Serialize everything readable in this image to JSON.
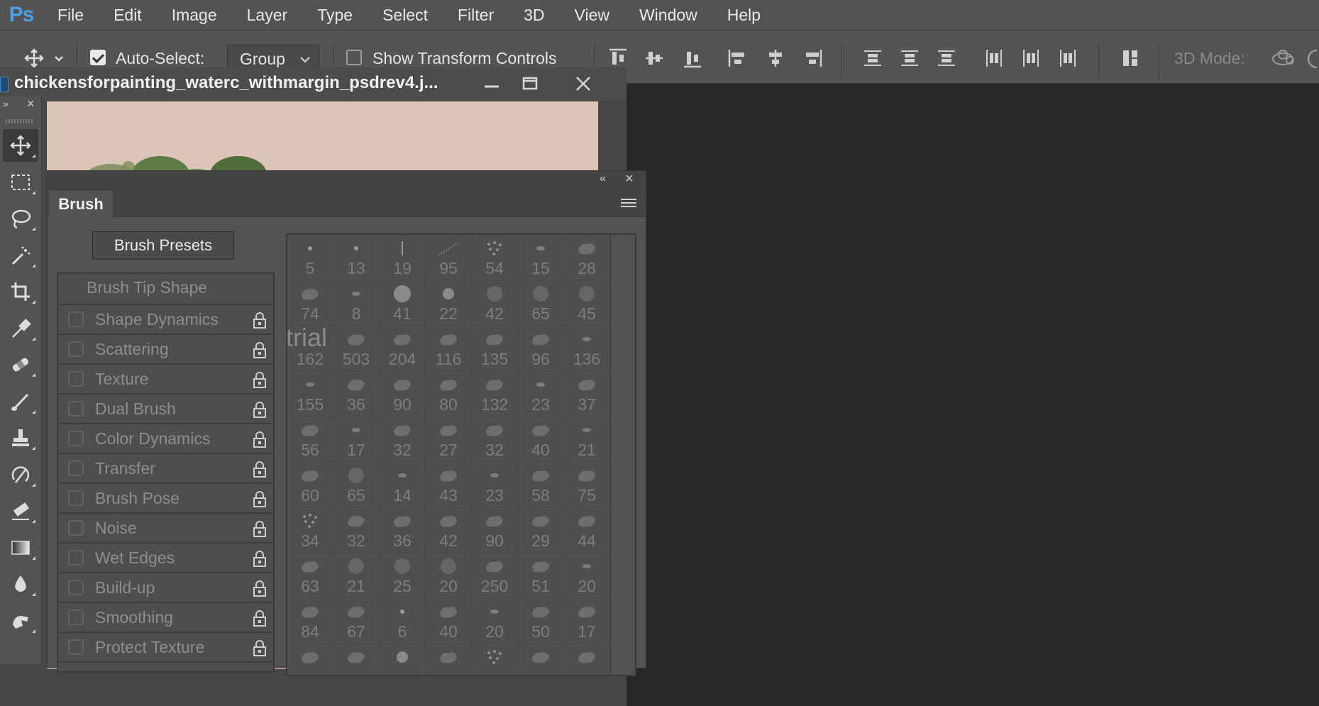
{
  "app": {
    "logo": "Ps"
  },
  "menu": [
    "File",
    "Edit",
    "Image",
    "Layer",
    "Type",
    "Select",
    "Filter",
    "3D",
    "View",
    "Window",
    "Help"
  ],
  "options_bar": {
    "auto_select_label": "Auto-Select:",
    "auto_select_checked": true,
    "group_value": "Group",
    "show_transform_label": "Show Transform Controls",
    "show_transform_checked": false,
    "mode_3d_label": "3D Mode:"
  },
  "document": {
    "title": "chickensforpainting_waterc_withmargin_psdrev4.j..."
  },
  "brush_panel": {
    "tab_label": "Brush",
    "presets_button": "Brush Presets",
    "tip_shape_label": "Brush Tip Shape",
    "options": [
      {
        "label": "Shape Dynamics",
        "checked": false
      },
      {
        "label": "Scattering",
        "checked": false
      },
      {
        "label": "Texture",
        "checked": false
      },
      {
        "label": "Dual Brush",
        "checked": false
      },
      {
        "label": "Color Dynamics",
        "checked": false
      },
      {
        "label": "Transfer",
        "checked": false
      },
      {
        "label": "Brush Pose",
        "checked": false
      },
      {
        "label": "Noise",
        "checked": false
      },
      {
        "label": "Wet Edges",
        "checked": false
      },
      {
        "label": "Build-up",
        "checked": false
      },
      {
        "label": "Smoothing",
        "checked": false
      },
      {
        "label": "Protect Texture",
        "checked": false
      }
    ],
    "trial_label": "trial",
    "tip_sizes": [
      "5",
      "13",
      "19",
      "95",
      "54",
      "15",
      "28",
      "74",
      "8",
      "41",
      "22",
      "42",
      "65",
      "45",
      "162",
      "503",
      "204",
      "116",
      "135",
      "96",
      "136",
      "155",
      "36",
      "90",
      "80",
      "132",
      "23",
      "37",
      "56",
      "17",
      "32",
      "27",
      "32",
      "40",
      "21",
      "60",
      "65",
      "14",
      "43",
      "23",
      "58",
      "75",
      "34",
      "32",
      "36",
      "42",
      "90",
      "29",
      "44",
      "63",
      "21",
      "25",
      "20",
      "250",
      "51",
      "20",
      "84",
      "67",
      "6",
      "40",
      "20",
      "50",
      "17",
      "",
      "",
      "",
      "",
      "",
      "",
      ""
    ]
  },
  "colors": {
    "menubar": "#535353",
    "workspace": "#282828",
    "canvas": "#dbc4b8",
    "logo": "#4ea0e6"
  },
  "tools": [
    "move-tool",
    "marquee-tool",
    "lasso-tool",
    "magic-wand-tool",
    "crop-tool",
    "eyedropper-tool",
    "healing-tool",
    "brush-tool",
    "stamp-tool",
    "history-brush-tool",
    "eraser-tool",
    "gradient-tool",
    "blur-tool",
    "smudge-tool"
  ]
}
